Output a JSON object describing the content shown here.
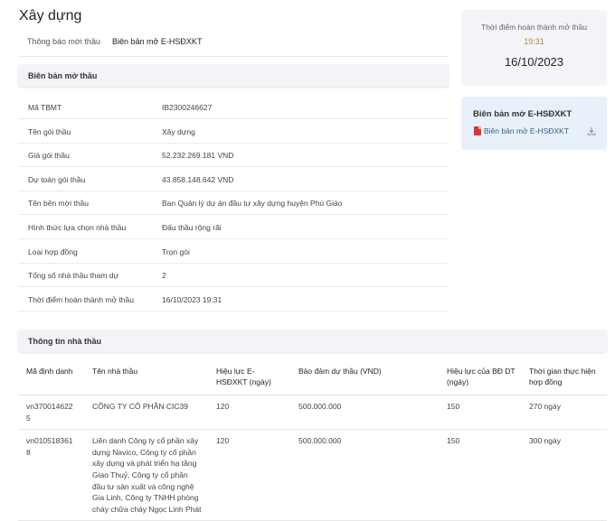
{
  "page_title": "Xây dựng",
  "tabs": [
    {
      "label": "Thông báo mời thầu"
    },
    {
      "label": "Biên bản mở E-HSĐXKT"
    }
  ],
  "opening_minutes": {
    "header": "Biên bản mở thầu",
    "rows": [
      {
        "label": "Mã TBMT",
        "value": "IB2300246627"
      },
      {
        "label": "Tên gói thầu",
        "value": "Xây dựng"
      },
      {
        "label": "Giá gói thầu",
        "value": "52.232.269.181 VND"
      },
      {
        "label": "Dự toán gói thầu",
        "value": "43.858.148.642 VND"
      },
      {
        "label": "Tên bên mời thầu",
        "value": "Ban Quản lý dự án đầu tư xây dựng huyện Phú Giáo"
      },
      {
        "label": "Hình thức lựa chọn nhà thầu",
        "value": "Đấu thầu rộng rãi"
      },
      {
        "label": "Loại hợp đồng",
        "value": "Trọn gói"
      },
      {
        "label": "Tổng số nhà thầu tham dự",
        "value": "2"
      },
      {
        "label": "Thời điểm hoàn thành mở thầu",
        "value": "16/10/2023 19:31"
      }
    ]
  },
  "completion_card": {
    "label": "Thời điểm hoàn thành mở thầu",
    "time": "19:31",
    "date": "16/10/2023"
  },
  "document_card": {
    "title": "Biên bản mở E-HSĐXKT",
    "link_label": "Biên bản mở E-HSĐXKT",
    "file_icon": "pdf-icon",
    "action_icon": "download-icon"
  },
  "bidders": {
    "header": "Thông tin nhà thầu",
    "columns": [
      "Mã định danh",
      "Tên nhà thầu",
      "Hiệu lực E-HSĐXKT (ngày)",
      "Bảo đảm dự thầu (VND)",
      "Hiệu lực của BĐ DT (ngày)",
      "Thời gian thực hiện hợp đồng"
    ],
    "rows": [
      {
        "id": "vn370014622 5",
        "name": "CÔNG TY CỔ PHẦN CIC39",
        "validity": "120",
        "bond": "500.000.000",
        "bond_validity": "150",
        "duration": "270 ngày"
      },
      {
        "id": "vn010518361 8",
        "name": "Liên danh Công ty cổ phần xây dựng Navico, Công ty cổ phần xây dựng và phát triển hạ tầng Giao Thuỷ, Công ty cổ phần đầu tư sản xuất và công nghệ Gia Linh, Công ty TNHH phòng cháy chữa cháy Ngọc Linh Phát",
        "validity": "120",
        "bond": "500.000.000",
        "bond_validity": "150",
        "duration": "300 ngày"
      }
    ]
  }
}
